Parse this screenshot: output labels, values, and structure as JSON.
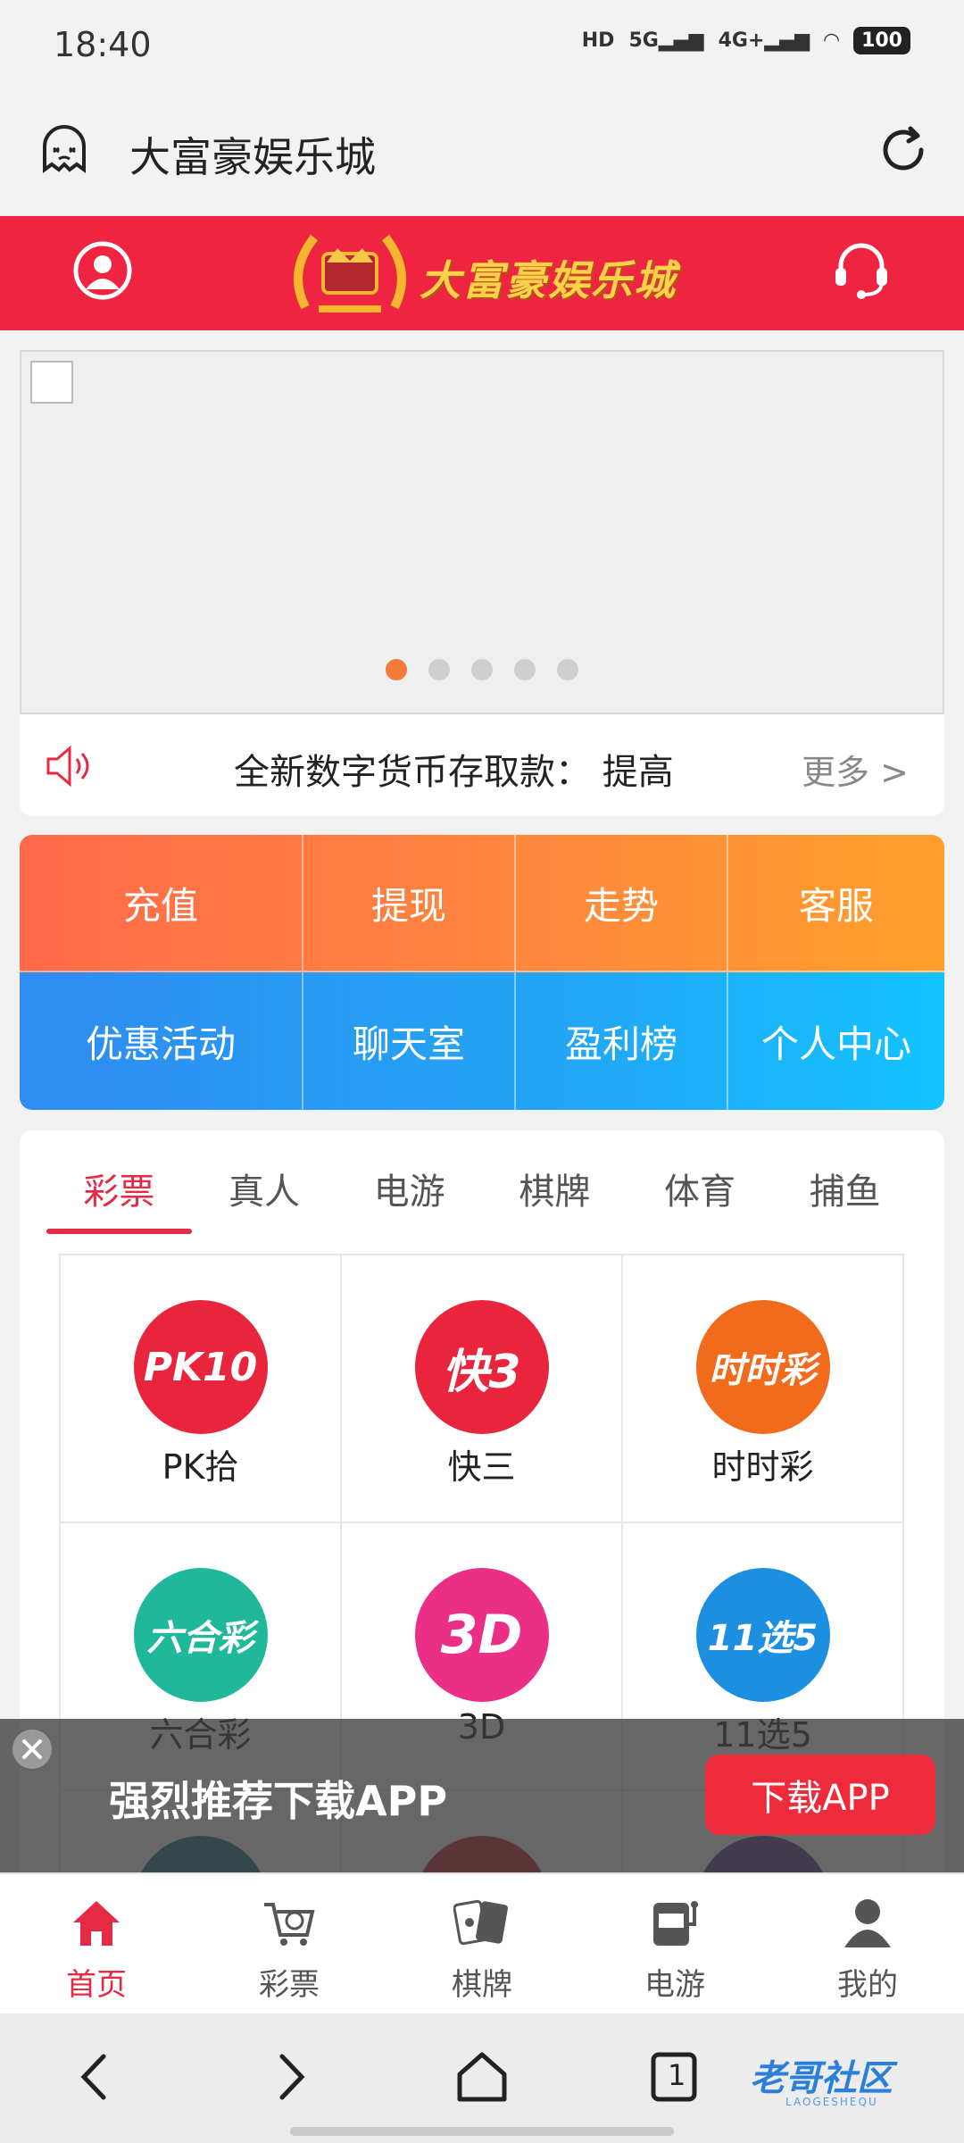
{
  "status_bar": {
    "time": "18:40",
    "indicators": [
      "HD",
      "5G",
      "4G+",
      "wifi"
    ],
    "battery": "100"
  },
  "browser": {
    "title": "大富豪娱乐城"
  },
  "header": {
    "brand": "大富豪娱乐城",
    "colors": {
      "bar": "#ee2441",
      "brand_text": "#ffd04a"
    }
  },
  "banner": {
    "pages": 5,
    "active_page": 1
  },
  "notice": {
    "text": "全新数字货币存取款： 提高",
    "more": "更多 >"
  },
  "quick_actions": {
    "row1": [
      "充值",
      "提现",
      "走势",
      "客服"
    ],
    "row2": [
      "优惠活动",
      "聊天室",
      "盈利榜",
      "个人中心"
    ]
  },
  "game_tabs": [
    "彩票",
    "真人",
    "电游",
    "棋牌",
    "体育",
    "捕鱼"
  ],
  "games": [
    {
      "label": "PK拾",
      "icon_text": "PK10",
      "color": "#e8253d"
    },
    {
      "label": "快三",
      "icon_text": "快3",
      "color": "#e8253d"
    },
    {
      "label": "时时彩",
      "icon_text": "时时彩",
      "color": "#f26b1d"
    },
    {
      "label": "六合彩",
      "icon_text": "六合彩",
      "color": "#1fb89a"
    },
    {
      "label": "3D",
      "icon_text": "3D",
      "color": "#ec2f86"
    },
    {
      "label": "11选5",
      "icon_text": "11选5",
      "color": "#1c8fe0"
    }
  ],
  "download_bar": {
    "message": "强烈推荐下载APP",
    "button": "下载APP"
  },
  "tab_bar": [
    {
      "label": "首页",
      "icon": "home-icon",
      "active": true
    },
    {
      "label": "彩票",
      "icon": "lottery-cart-icon",
      "active": false
    },
    {
      "label": "棋牌",
      "icon": "cards-icon",
      "active": false
    },
    {
      "label": "电游",
      "icon": "slot-machine-icon",
      "active": false
    },
    {
      "label": "我的",
      "icon": "profile-icon",
      "active": false
    }
  ],
  "system_nav": {
    "tab_count": "1",
    "watermark": "老哥社区",
    "watermark_sub": "LAOGESHEQU"
  }
}
